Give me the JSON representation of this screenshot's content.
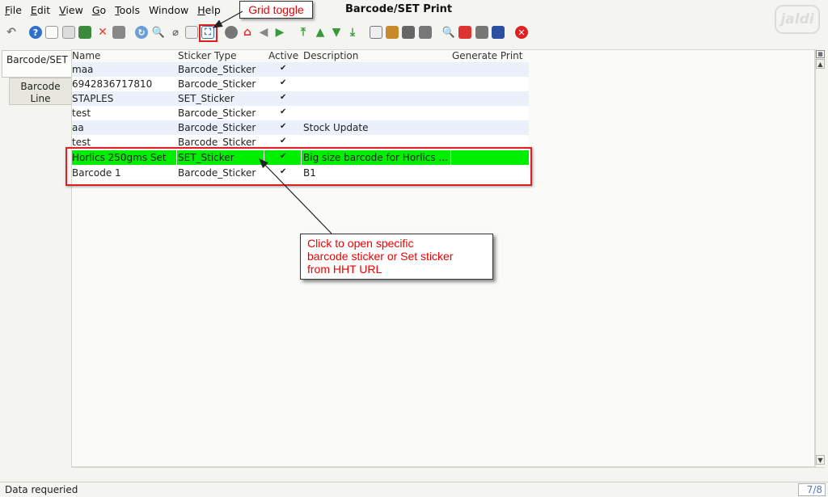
{
  "menu": [
    {
      "underline": "F",
      "rest": "ile"
    },
    {
      "underline": "E",
      "rest": "dit"
    },
    {
      "underline": "V",
      "rest": "iew"
    },
    {
      "underline": "G",
      "rest": "o"
    },
    {
      "underline": "T",
      "rest": "ools"
    },
    {
      "underline": "",
      "rest": "Window"
    },
    {
      "underline": "H",
      "rest": "elp"
    }
  ],
  "window_title": "Barcode/SET Print",
  "brand": "jaldi",
  "tabs": [
    {
      "label": "Barcode/SET"
    },
    {
      "label": "Barcode Line"
    }
  ],
  "grid": {
    "columns": [
      "Name",
      "Sticker Type",
      "Active",
      "Description",
      "Generate Print"
    ],
    "rows": [
      {
        "name": "maa",
        "type": "Barcode_Sticker",
        "active": "✔",
        "description": "",
        "generate": ""
      },
      {
        "name": "6942836717810",
        "type": "Barcode_Sticker",
        "active": "✔",
        "description": "",
        "generate": ""
      },
      {
        "name": "STAPLES",
        "type": "SET_Sticker",
        "active": "✔",
        "description": "",
        "generate": ""
      },
      {
        "name": "test",
        "type": "Barcode_Sticker",
        "active": "✔",
        "description": "",
        "generate": ""
      },
      {
        "name": "aa",
        "type": "Barcode_Sticker",
        "active": "✔",
        "description": "Stock Update",
        "generate": ""
      },
      {
        "name": "test",
        "type": "Barcode_Sticker",
        "active": "✔",
        "description": "",
        "generate": ""
      },
      {
        "name": "Horlics 250gms Set",
        "type": "SET_Sticker",
        "active": "✔",
        "description": "Big size barcode for Horlics ...",
        "generate": ""
      },
      {
        "name": "Barcode 1",
        "type": "Barcode_Sticker",
        "active": "✔",
        "description": "B1",
        "generate": ""
      }
    ],
    "selected_row_index": 6
  },
  "status": {
    "message": "Data requeried",
    "record_count": "7/8"
  },
  "annotations": {
    "grid_toggle": "Grid toggle",
    "hint": [
      "Click to open specific",
      "barcode sticker or Set sticker",
      "from HHT URL"
    ]
  },
  "colors": {
    "selected_row": "#00ee00",
    "alt_row": "#eaf1fa",
    "annotation": "#e02020"
  }
}
